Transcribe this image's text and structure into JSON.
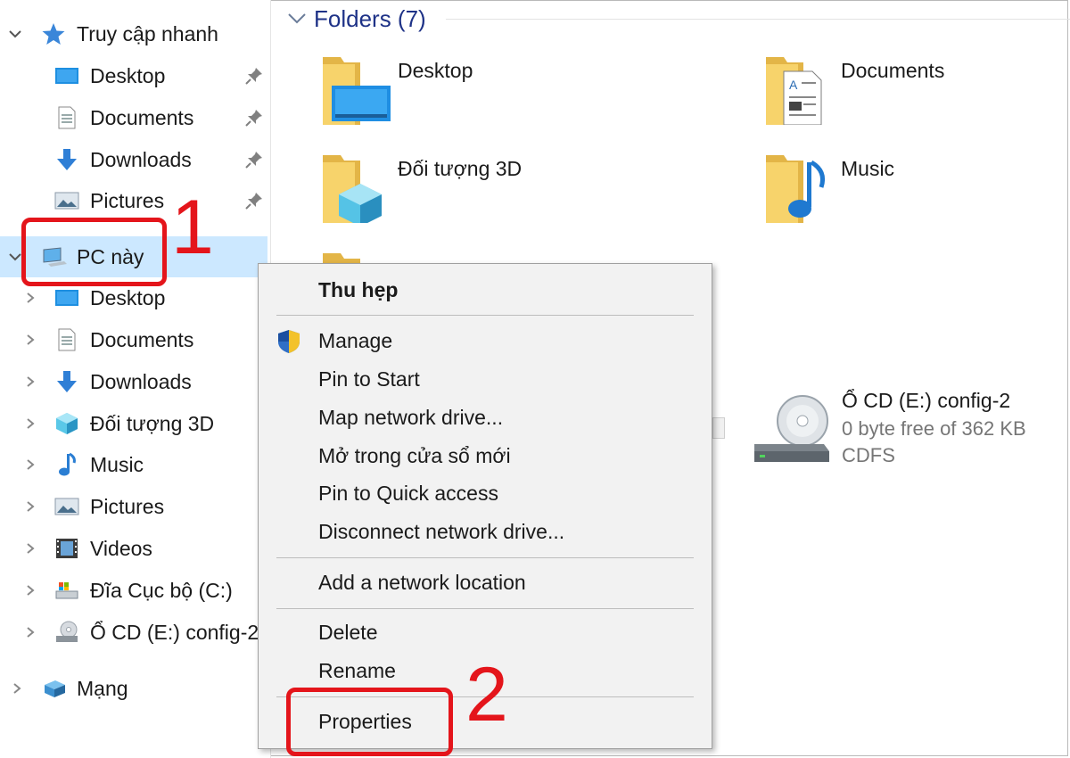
{
  "nav": {
    "quick_access": {
      "label": "Truy cập nhanh",
      "icon": "star-icon"
    },
    "quick_items": [
      {
        "label": "Desktop",
        "icon": "desktop-icon"
      },
      {
        "label": "Documents",
        "icon": "documents-icon"
      },
      {
        "label": "Downloads",
        "icon": "downloads-icon"
      },
      {
        "label": "Pictures",
        "icon": "pictures-icon"
      }
    ],
    "this_pc": {
      "label": "PC này",
      "icon": "computer-icon"
    },
    "pc_items": [
      {
        "label": "Desktop",
        "icon": "desktop-icon"
      },
      {
        "label": "Documents",
        "icon": "documents-icon"
      },
      {
        "label": "Downloads",
        "icon": "downloads-icon"
      },
      {
        "label": "Đối tượng 3D",
        "icon": "3d-objects-icon"
      },
      {
        "label": "Music",
        "icon": "music-icon"
      },
      {
        "label": "Pictures",
        "icon": "pictures-icon"
      },
      {
        "label": "Videos",
        "icon": "videos-icon"
      },
      {
        "label": "Đĩa Cục bộ (C:)",
        "icon": "local-disk-icon"
      },
      {
        "label": "Ổ CD (E:) config-2",
        "icon": "cd-drive-icon"
      }
    ],
    "network": {
      "label": "Mạng",
      "icon": "network-icon"
    }
  },
  "content": {
    "folders_header": "Folders (7)",
    "folders": [
      {
        "label": "Desktop",
        "icon": "desktop-folder-icon"
      },
      {
        "label": "Documents",
        "icon": "documents-folder-icon"
      },
      {
        "label": "Đối tượng 3D",
        "icon": "3d-folder-icon"
      },
      {
        "label": "Music",
        "icon": "music-folder-icon"
      }
    ],
    "drive": {
      "name": "Ổ CD (E:) config-2",
      "free": "0 byte free of 362 KB",
      "fs": "CDFS",
      "icon": "cd-drive-icon"
    }
  },
  "context_menu": {
    "items": [
      {
        "label": "Thu hẹp",
        "bold": true
      },
      {
        "label": "Manage",
        "icon": "uac-shield-icon"
      },
      {
        "label": "Pin to Start"
      },
      {
        "label": "Map network drive..."
      },
      {
        "label": "Mở trong cửa sổ mới"
      },
      {
        "label": "Pin to Quick access"
      },
      {
        "label": "Disconnect network drive..."
      },
      {
        "label": "Add a network location"
      },
      {
        "label": "Delete"
      },
      {
        "label": "Rename"
      },
      {
        "label": "Properties"
      }
    ]
  },
  "annotations": {
    "step1": "1",
    "step2": "2",
    "color": "#e4151b"
  },
  "colors": {
    "selection": "#cce8ff",
    "header_blue": "#1e3287",
    "folder_yellow": "#f3c44f"
  }
}
